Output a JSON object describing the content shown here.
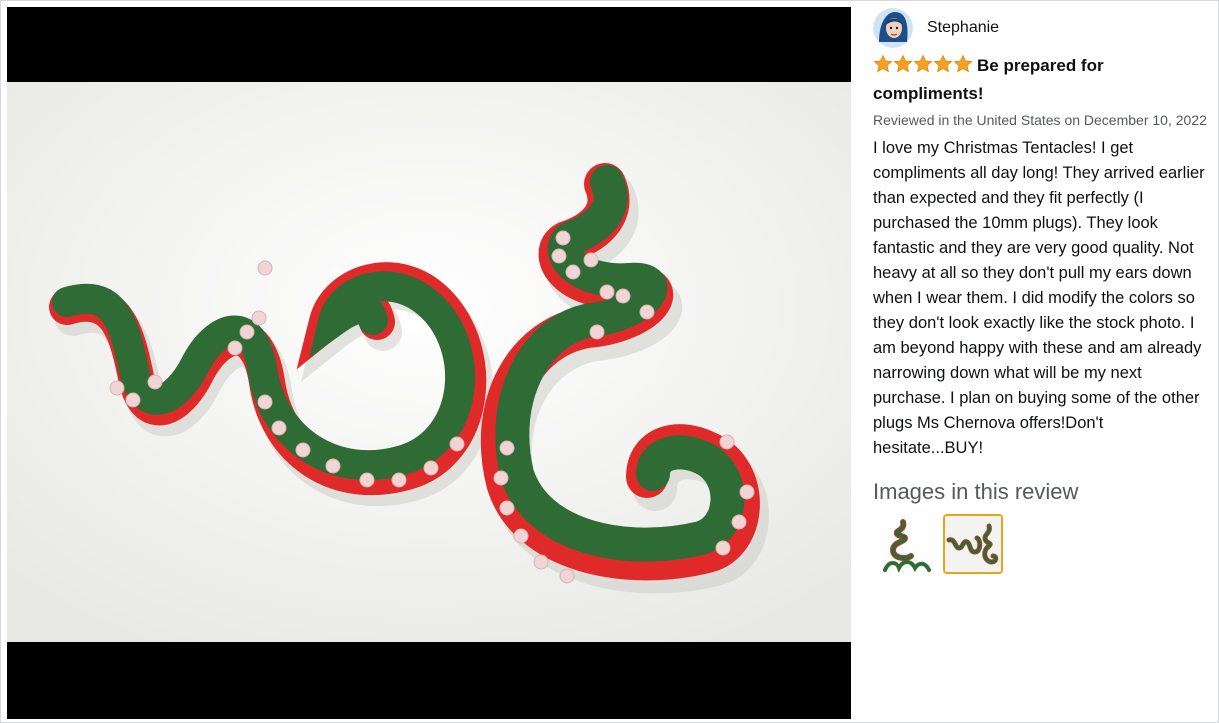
{
  "review": {
    "reviewer_name": "Stephanie",
    "rating": 5,
    "title": "Be prepared for compliments!",
    "meta": "Reviewed in the United States on December 10, 2022",
    "body": "I love my Christmas Tentacles! I get compliments all day long! They arrived earlier than expected and they fit perfectly (I purchased the 10mm plugs). They look fantastic and they are very good quality. Not heavy at all so they don't pull my ears down when I wear them. I did modify the colors so they don't look exactly like the stock photo. I am beyond happy with these and am already narrowing down what will be my next purchase. I plan on buying some of the other plugs Ms Chernova offers!Don't hesitate...BUY!"
  },
  "images_section": {
    "heading": "Images in this review",
    "thumbnails": [
      {
        "name": "thumbnail-1",
        "selected": false
      },
      {
        "name": "thumbnail-2",
        "selected": true
      }
    ]
  },
  "colors": {
    "star": "#f79f1f",
    "tentacle_green": "#2f6b34",
    "tentacle_red": "#e02a2a",
    "sucker": "#f1d4d4",
    "selected_border": "#e8a317"
  }
}
